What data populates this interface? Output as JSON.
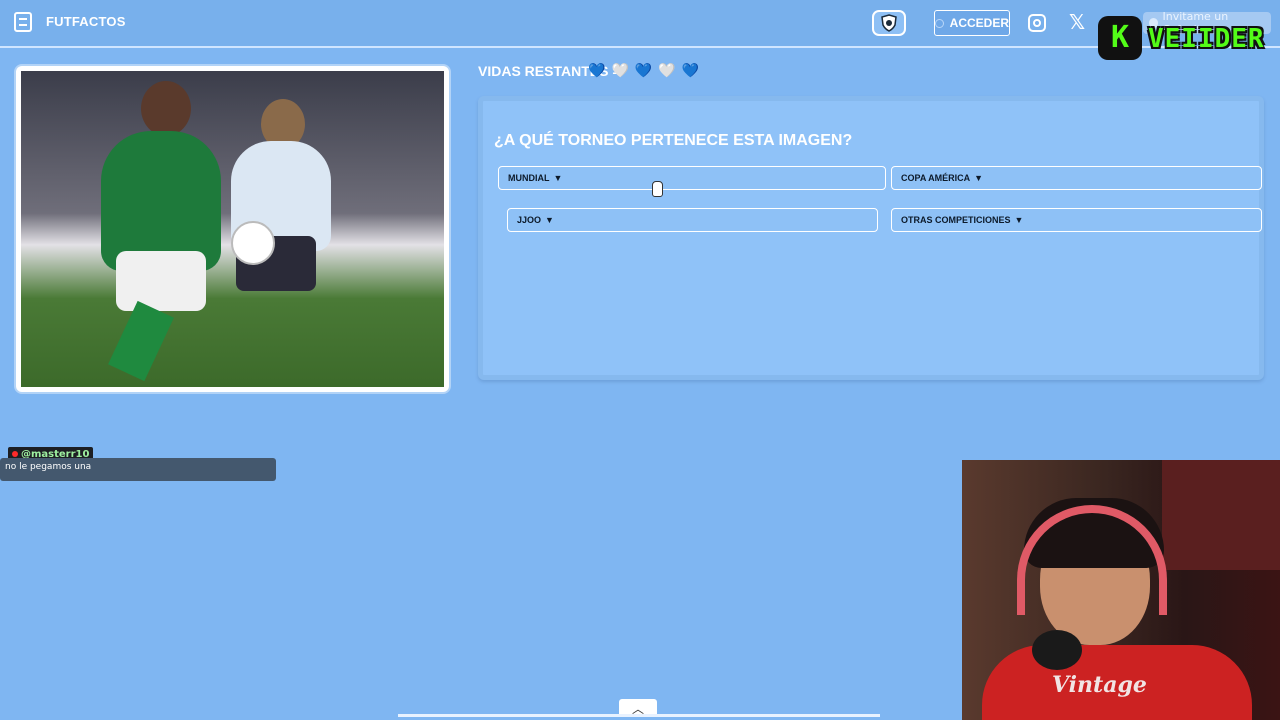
{
  "header": {
    "site_name": "FUTFACTOS",
    "access_label": "ACCEDER",
    "cafecito_label": "Invitame un Cafecito"
  },
  "overlay": {
    "streamer_badge": "K",
    "streamer_name": "VEIIDER"
  },
  "game": {
    "lives_label": "VIDAS RESTANTES =",
    "lives": [
      {
        "icon": "blue-heart",
        "glyph": "💙"
      },
      {
        "icon": "white-heart",
        "glyph": "🤍"
      },
      {
        "icon": "blue-heart",
        "glyph": "💙"
      },
      {
        "icon": "white-heart",
        "glyph": "🤍"
      },
      {
        "icon": "blue-heart",
        "glyph": "💙"
      }
    ],
    "question": "¿A QUÉ TORNEO PERTENECE ESTA IMAGEN?",
    "options": [
      {
        "label": "MUNDIAL",
        "caret": "▼"
      },
      {
        "label": "COPA AMÉRICA",
        "caret": "▼"
      },
      {
        "label": "JJOO",
        "caret": "▼"
      },
      {
        "label": "OTRAS COMPETICIONES",
        "caret": "▼"
      }
    ]
  },
  "chat": {
    "username": "@masterr10",
    "message": "no le pegamos una"
  },
  "webcam": {
    "shirt_text": "Vintage"
  },
  "colors": {
    "background": "#7fb6f2",
    "panel": "#8fc2f8",
    "streamer_green": "#53fc18"
  }
}
